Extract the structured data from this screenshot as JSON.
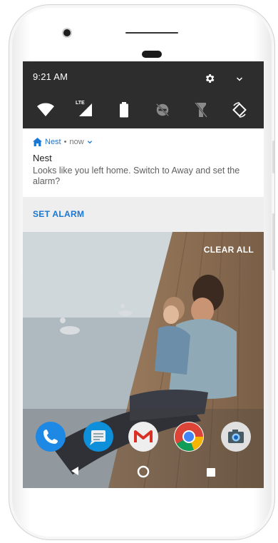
{
  "status": {
    "time": "9:21 AM",
    "signal_tag": "LTE"
  },
  "quick_settings": {
    "icons": [
      "wifi-icon",
      "lte-signal-icon",
      "battery-icon",
      "do-not-disturb-icon",
      "flashlight-icon",
      "auto-rotate-icon"
    ]
  },
  "notification": {
    "app_name": "Nest",
    "separator": "•",
    "time": "now",
    "title": "Nest",
    "body": "Looks like you left home. Switch to Away and set the alarm?",
    "action": "SET ALARM"
  },
  "wallpaper": {
    "clear_all": "CLEAR ALL"
  },
  "dock": {
    "apps": [
      "phone",
      "messages",
      "gmail",
      "chrome",
      "camera"
    ]
  },
  "colors": {
    "accent": "#1976d2",
    "qs_bg": "#2d2d2d",
    "action_bg": "#eeeeee"
  }
}
